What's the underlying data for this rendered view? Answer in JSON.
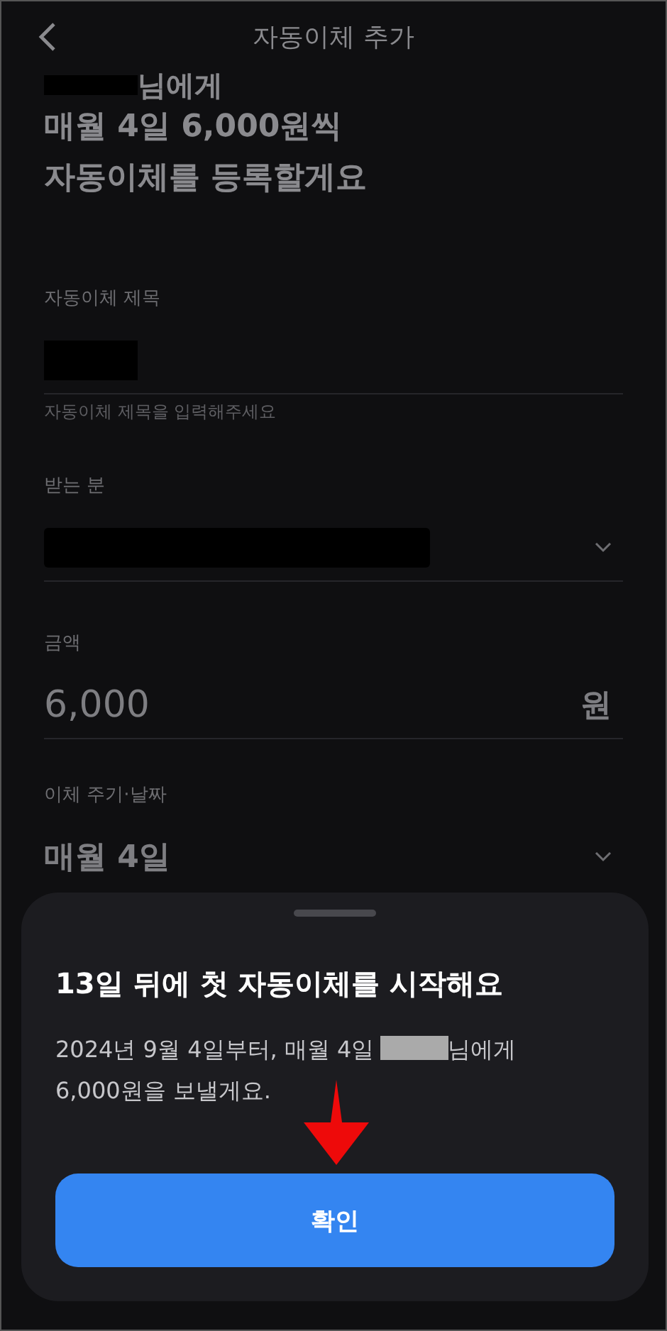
{
  "header": {
    "title": "자동이체 추가"
  },
  "summary": {
    "recipient_suffix": "님에게",
    "lines": [
      "매월 4일 6,000원씩",
      "자동이체를 등록할게요"
    ]
  },
  "fields": [
    {
      "kind": "text",
      "label": "자동이체 제목",
      "helper": "자동이체 제목을 입력해주세요"
    },
    {
      "kind": "select",
      "label": "받는 분"
    },
    {
      "kind": "amount",
      "label": "금액",
      "value": "6,000",
      "unit": "원"
    },
    {
      "kind": "select",
      "label": "이체 주기·날짜",
      "value": "매월 4일"
    }
  ],
  "sheet": {
    "title": "13일 뒤에 첫 자동이체를 시작해요",
    "message_line_1_before": "2024년 9월 4일부터, 매월 4일",
    "message_line_1_after": "님에게",
    "message_line_2": "6,000원을 보낼게요.",
    "button": "확인"
  }
}
